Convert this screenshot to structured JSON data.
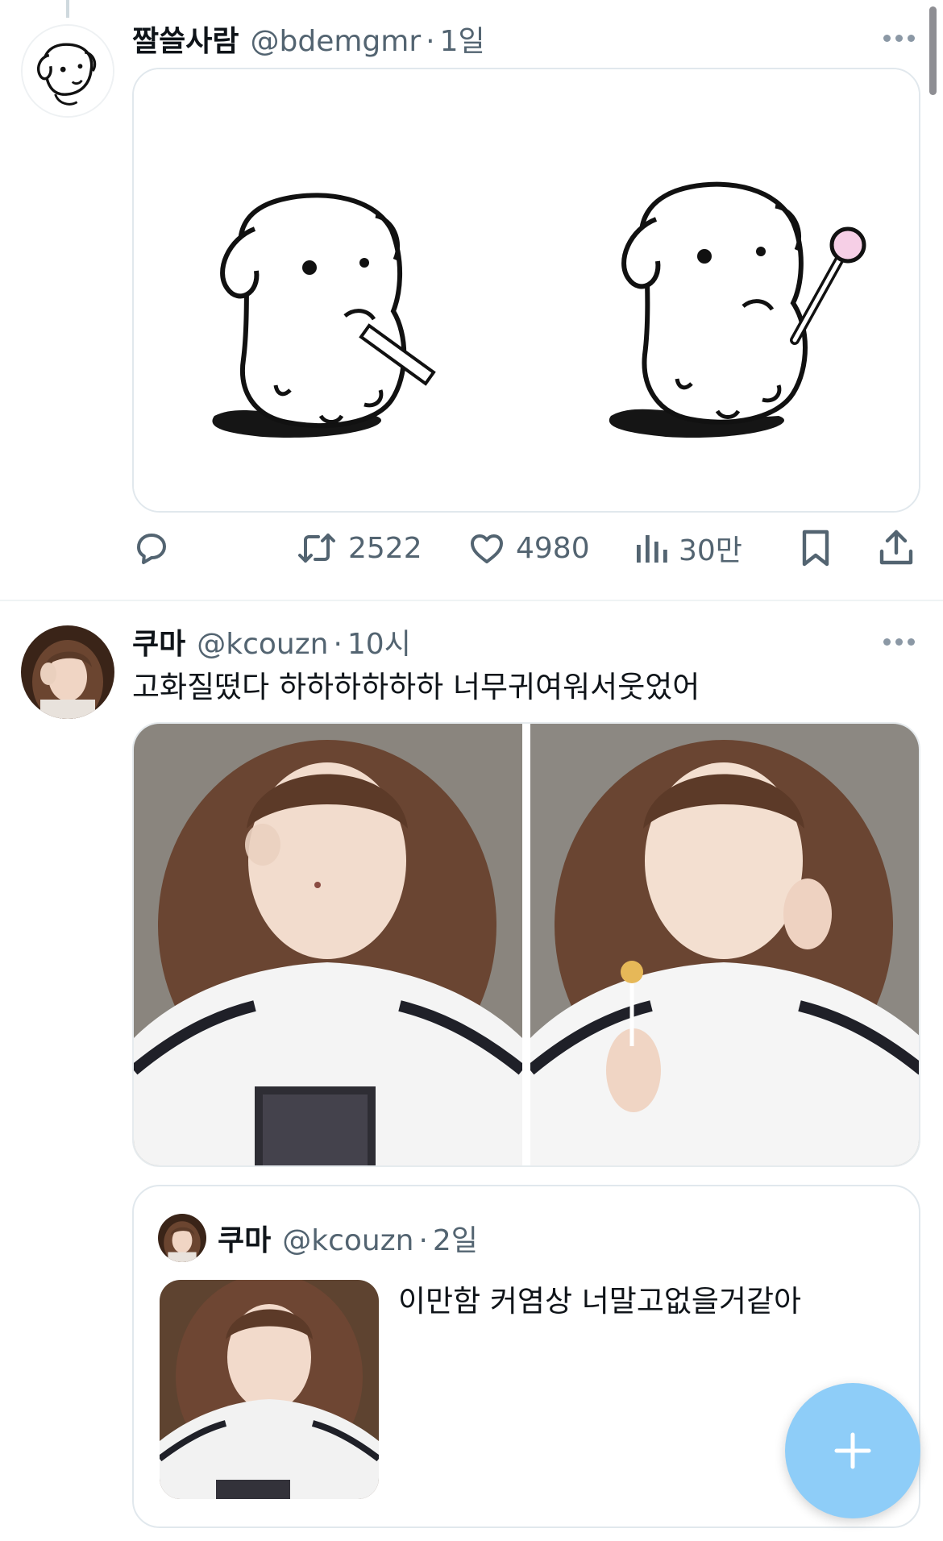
{
  "tweet1": {
    "author_name": "짤쓸사람",
    "handle": "@bdemgmr",
    "separator": "·",
    "time": "1일",
    "avatar_icon": "dog-doodle-avatar",
    "media_icon": "dog-doodle-illustration",
    "actions": {
      "reply_icon": "reply-icon",
      "retweet_icon": "retweet-icon",
      "retweet_count": "2522",
      "like_icon": "heart-icon",
      "like_count": "4980",
      "views_icon": "views-chart-icon",
      "views_count": "30만",
      "bookmark_icon": "bookmark-icon",
      "share_icon": "share-icon"
    }
  },
  "tweet2": {
    "author_name": "쿠마",
    "handle": "@kcouzn",
    "separator": "·",
    "time": "10시",
    "text": "고화질떴다 하하하하하하 너무귀여워서웃었어",
    "photos": [
      "photo-left",
      "photo-right"
    ],
    "quote": {
      "author_name": "쿠마",
      "handle": "@kcouzn",
      "separator": "·",
      "time": "2일",
      "text": "이만함 커염상 너말고없을거같아"
    }
  },
  "fab": {
    "icon": "plus-icon"
  },
  "colors": {
    "text_primary": "#0f1419",
    "text_secondary": "#536471",
    "border": "#e1e8ed",
    "fab": "#8ecdf8"
  }
}
